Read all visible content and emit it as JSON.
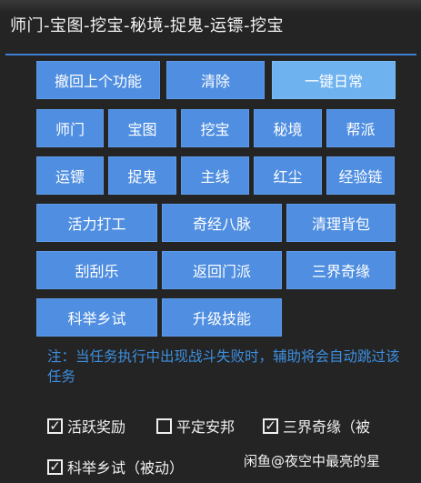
{
  "title": "师门-宝图-挖宝-秘境-捉鬼-运镖-挖宝",
  "buttons": {
    "undo": "撤回上个功能",
    "clear": "清除",
    "oneclick": "一键日常",
    "shimen": "师门",
    "baotu": "宝图",
    "wabao": "挖宝",
    "mijing": "秘境",
    "bangpai": "帮派",
    "yunbiao": "运镖",
    "zhuogui": "捉鬼",
    "zhuxian": "主线",
    "hongchen": "红尘",
    "jingyanlian": "经验链",
    "huoli": "活力打工",
    "qijing": "奇经八脉",
    "qingli": "清理背包",
    "guagua": "刮刮乐",
    "fanhui": "返回门派",
    "sanjie": "三界奇缘",
    "keju": "科举乡试",
    "shengji": "升级技能"
  },
  "note": "注：当任务执行中出现战斗失败时，辅助将会自动跳过该任务",
  "checkboxes": [
    {
      "label": "活跃奖励",
      "mark": "✓",
      "checked": true
    },
    {
      "label": "平定安邦",
      "mark": "",
      "checked": false
    },
    {
      "label": "三界奇缘（被",
      "mark": "✓",
      "checked": true
    },
    {
      "label": "科举乡试（被动）",
      "mark": "✓",
      "checked": true
    }
  ],
  "watermark": "闲鱼@夜空中最亮的星",
  "colors": {
    "button": "#4f8ee0",
    "button_light": "#6eb2f0",
    "accent": "#3f7fd1",
    "note": "#3d8fe0"
  }
}
